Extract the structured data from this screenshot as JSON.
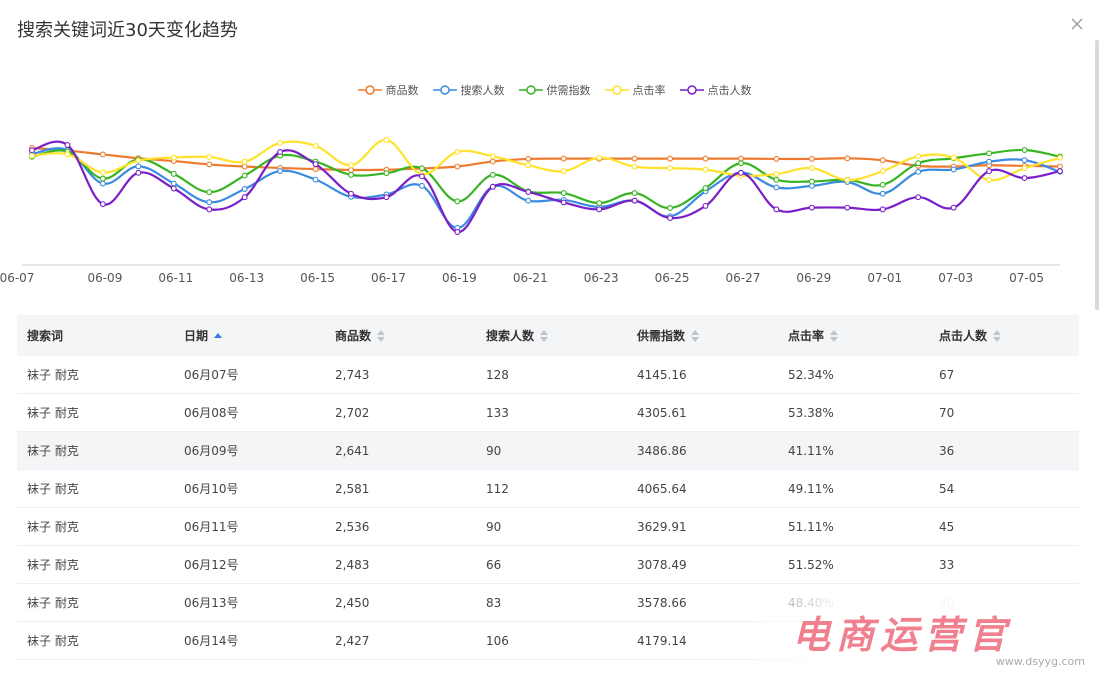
{
  "modal": {
    "title": "搜索关键词近30天变化趋势"
  },
  "legend": [
    {
      "label": "商品数",
      "color": "#ee7a2f"
    },
    {
      "label": "搜索人数",
      "color": "#3b8be0"
    },
    {
      "label": "供需指数",
      "color": "#37b422"
    },
    {
      "label": "点击率",
      "color": "#ffe22b"
    },
    {
      "label": "点击人数",
      "color": "#7a1fc8"
    }
  ],
  "chart_data": {
    "type": "line",
    "x": [
      "06-07",
      "06-08",
      "06-09",
      "06-10",
      "06-11",
      "06-12",
      "06-13",
      "06-14",
      "06-15",
      "06-16",
      "06-17",
      "06-18",
      "06-19",
      "06-20",
      "06-21",
      "06-22",
      "06-23",
      "06-24",
      "06-25",
      "06-26",
      "06-27",
      "06-28",
      "06-29",
      "06-30",
      "07-01",
      "07-02",
      "07-03",
      "07-04",
      "07-05",
      "07-06"
    ],
    "tick_labels": [
      "06-07",
      "06-09",
      "06-11",
      "06-13",
      "06-15",
      "06-17",
      "06-19",
      "06-21",
      "06-23",
      "06-25",
      "06-27",
      "06-29",
      "07-01",
      "07-03",
      "07-05"
    ],
    "y_axis_visible": false,
    "grid": false,
    "legend_position": "top-center",
    "series": [
      {
        "name": "商品数",
        "color": "#ee7a2f",
        "values": [
          2743,
          2702,
          2641,
          2581,
          2536,
          2483,
          2450,
          2427,
          2410,
          2395,
          2400,
          2420,
          2450,
          2530,
          2570,
          2575,
          2575,
          2575,
          2575,
          2575,
          2575,
          2570,
          2570,
          2580,
          2550,
          2460,
          2450,
          2470,
          2460,
          2450
        ]
      },
      {
        "name": "搜索人数",
        "color": "#3b8be0",
        "values": [
          128,
          133,
          90,
          112,
          90,
          66,
          83,
          106,
          95,
          73,
          76,
          87,
          33,
          86,
          68,
          69,
          60,
          68,
          48,
          80,
          104,
          85,
          87,
          92,
          77,
          105,
          108,
          118,
          120,
          105
        ]
      },
      {
        "name": "供需指数",
        "color": "#37b422",
        "values": [
          4145.16,
          4305.61,
          3486.86,
          4065.64,
          3629.91,
          3078.49,
          3578.66,
          4179.14,
          4000,
          3600,
          3650,
          3800,
          2800,
          3600,
          3100,
          3050,
          2750,
          3050,
          2600,
          3200,
          3950,
          3450,
          3400,
          3450,
          3300,
          3950,
          4100,
          4250,
          4350,
          4150
        ]
      },
      {
        "name": "点击率",
        "color": "#ffe22b",
        "values": [
          52.34,
          53.38,
          41.11,
          49.11,
          51.11,
          51.52,
          48.4,
          61,
          59,
          46,
          63,
          40,
          55,
          52,
          46,
          42,
          51,
          45,
          44,
          43,
          39,
          40,
          44,
          36,
          42,
          52,
          51,
          36,
          44,
          51
        ]
      },
      {
        "name": "点击人数",
        "color": "#7a1fc8",
        "values": [
          67,
          70,
          36,
          54,
          45,
          33,
          40,
          66,
          59,
          42,
          40,
          52,
          20,
          46,
          43,
          37,
          33,
          38,
          28,
          35,
          54,
          33,
          34,
          34,
          33,
          40,
          34,
          55,
          51,
          55
        ]
      }
    ]
  },
  "table": {
    "columns": [
      "搜索词",
      "日期",
      "商品数",
      "搜索人数",
      "供需指数",
      "点击率",
      "点击人数"
    ],
    "rows": [
      [
        "袜子 耐克",
        "06月07号",
        "2,743",
        "128",
        "4145.16",
        "52.34%",
        "67"
      ],
      [
        "袜子 耐克",
        "06月08号",
        "2,702",
        "133",
        "4305.61",
        "53.38%",
        "70"
      ],
      [
        "袜子 耐克",
        "06月09号",
        "2,641",
        "90",
        "3486.86",
        "41.11%",
        "36"
      ],
      [
        "袜子 耐克",
        "06月10号",
        "2,581",
        "112",
        "4065.64",
        "49.11%",
        "54"
      ],
      [
        "袜子 耐克",
        "06月11号",
        "2,536",
        "90",
        "3629.91",
        "51.11%",
        "45"
      ],
      [
        "袜子 耐克",
        "06月12号",
        "2,483",
        "66",
        "3078.49",
        "51.52%",
        "33"
      ],
      [
        "袜子 耐克",
        "06月13号",
        "2,450",
        "83",
        "3578.66",
        "48.40%",
        "40"
      ],
      [
        "袜子 耐克",
        "06月14号",
        "2,427",
        "106",
        "4179.14",
        "",
        ""
      ]
    ]
  },
  "watermark": {
    "text": "电商运营官",
    "sub": "www.dsyyg.com"
  }
}
